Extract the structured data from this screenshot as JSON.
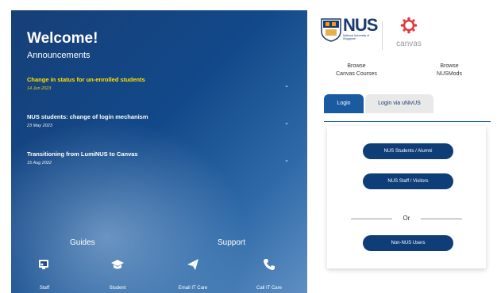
{
  "left": {
    "welcome": "Welcome!",
    "announcements_title": "Announcements",
    "announcements": [
      {
        "title": "Change in status for un-enrolled students",
        "date": "14 Jun 2023",
        "highlight": true
      },
      {
        "title": "NUS students: change of login mechanism",
        "date": "23 May 2023",
        "highlight": false
      },
      {
        "title": "Transitioning from LumiNUS to Canvas",
        "date": "15 Aug 2022",
        "highlight": false
      }
    ],
    "guides_title": "Guides",
    "support_title": "Support",
    "links": [
      {
        "label": "Staff",
        "icon": "staff-desktop-icon"
      },
      {
        "label": "Student",
        "icon": "graduation-cap-icon"
      },
      {
        "label": "Email IT Care",
        "icon": "paper-plane-icon"
      },
      {
        "label": "Call IT Care",
        "icon": "phone-icon"
      }
    ],
    "highlight_color": "#ffe100"
  },
  "right": {
    "nus_logo_text": "NUS",
    "nus_logo_subtext": "National University of Singapore",
    "canvas_logo_text": "canvas",
    "browse": [
      {
        "line1": "Browse",
        "line2": "Canvas Courses"
      },
      {
        "line1": "Browse",
        "line2": "NUSMods"
      }
    ],
    "tabs": [
      {
        "label": "Login",
        "active": true
      },
      {
        "label": "Login via uNivUS",
        "active": false
      }
    ],
    "buttons": [
      {
        "label": "NUS Students / Alumni"
      },
      {
        "label": "NUS Staff / Visitors"
      },
      {
        "label": "Non-NUS Users"
      }
    ],
    "or_label": "Or",
    "accent_color": "#0f3d78"
  }
}
